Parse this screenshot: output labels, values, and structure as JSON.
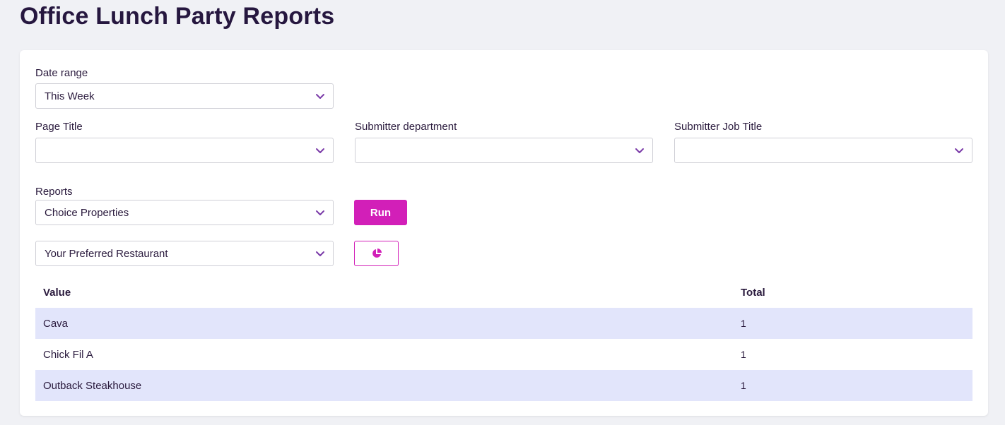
{
  "page": {
    "title": "Office Lunch Party Reports"
  },
  "filters": {
    "date_range": {
      "label": "Date range",
      "value": "This Week"
    },
    "page_title": {
      "label": "Page Title",
      "value": ""
    },
    "submitter_department": {
      "label": "Submitter department",
      "value": ""
    },
    "submitter_job_title": {
      "label": "Submitter Job Title",
      "value": ""
    }
  },
  "reports": {
    "label": "Reports",
    "report_type": "Choice Properties",
    "field": "Your Preferred Restaurant",
    "run_label": "Run",
    "chart_icon": "pie-chart-icon"
  },
  "table": {
    "headers": {
      "value": "Value",
      "total": "Total"
    },
    "rows": [
      {
        "value": "Cava",
        "total": "1"
      },
      {
        "value": "Chick Fil A",
        "total": "1"
      },
      {
        "value": "Outback Steakhouse",
        "total": "1"
      }
    ]
  },
  "colors": {
    "accent": "#d21fb8",
    "row_highlight": "#e2e5fb",
    "text": "#2a1a3d",
    "background": "#f0f1f5"
  }
}
